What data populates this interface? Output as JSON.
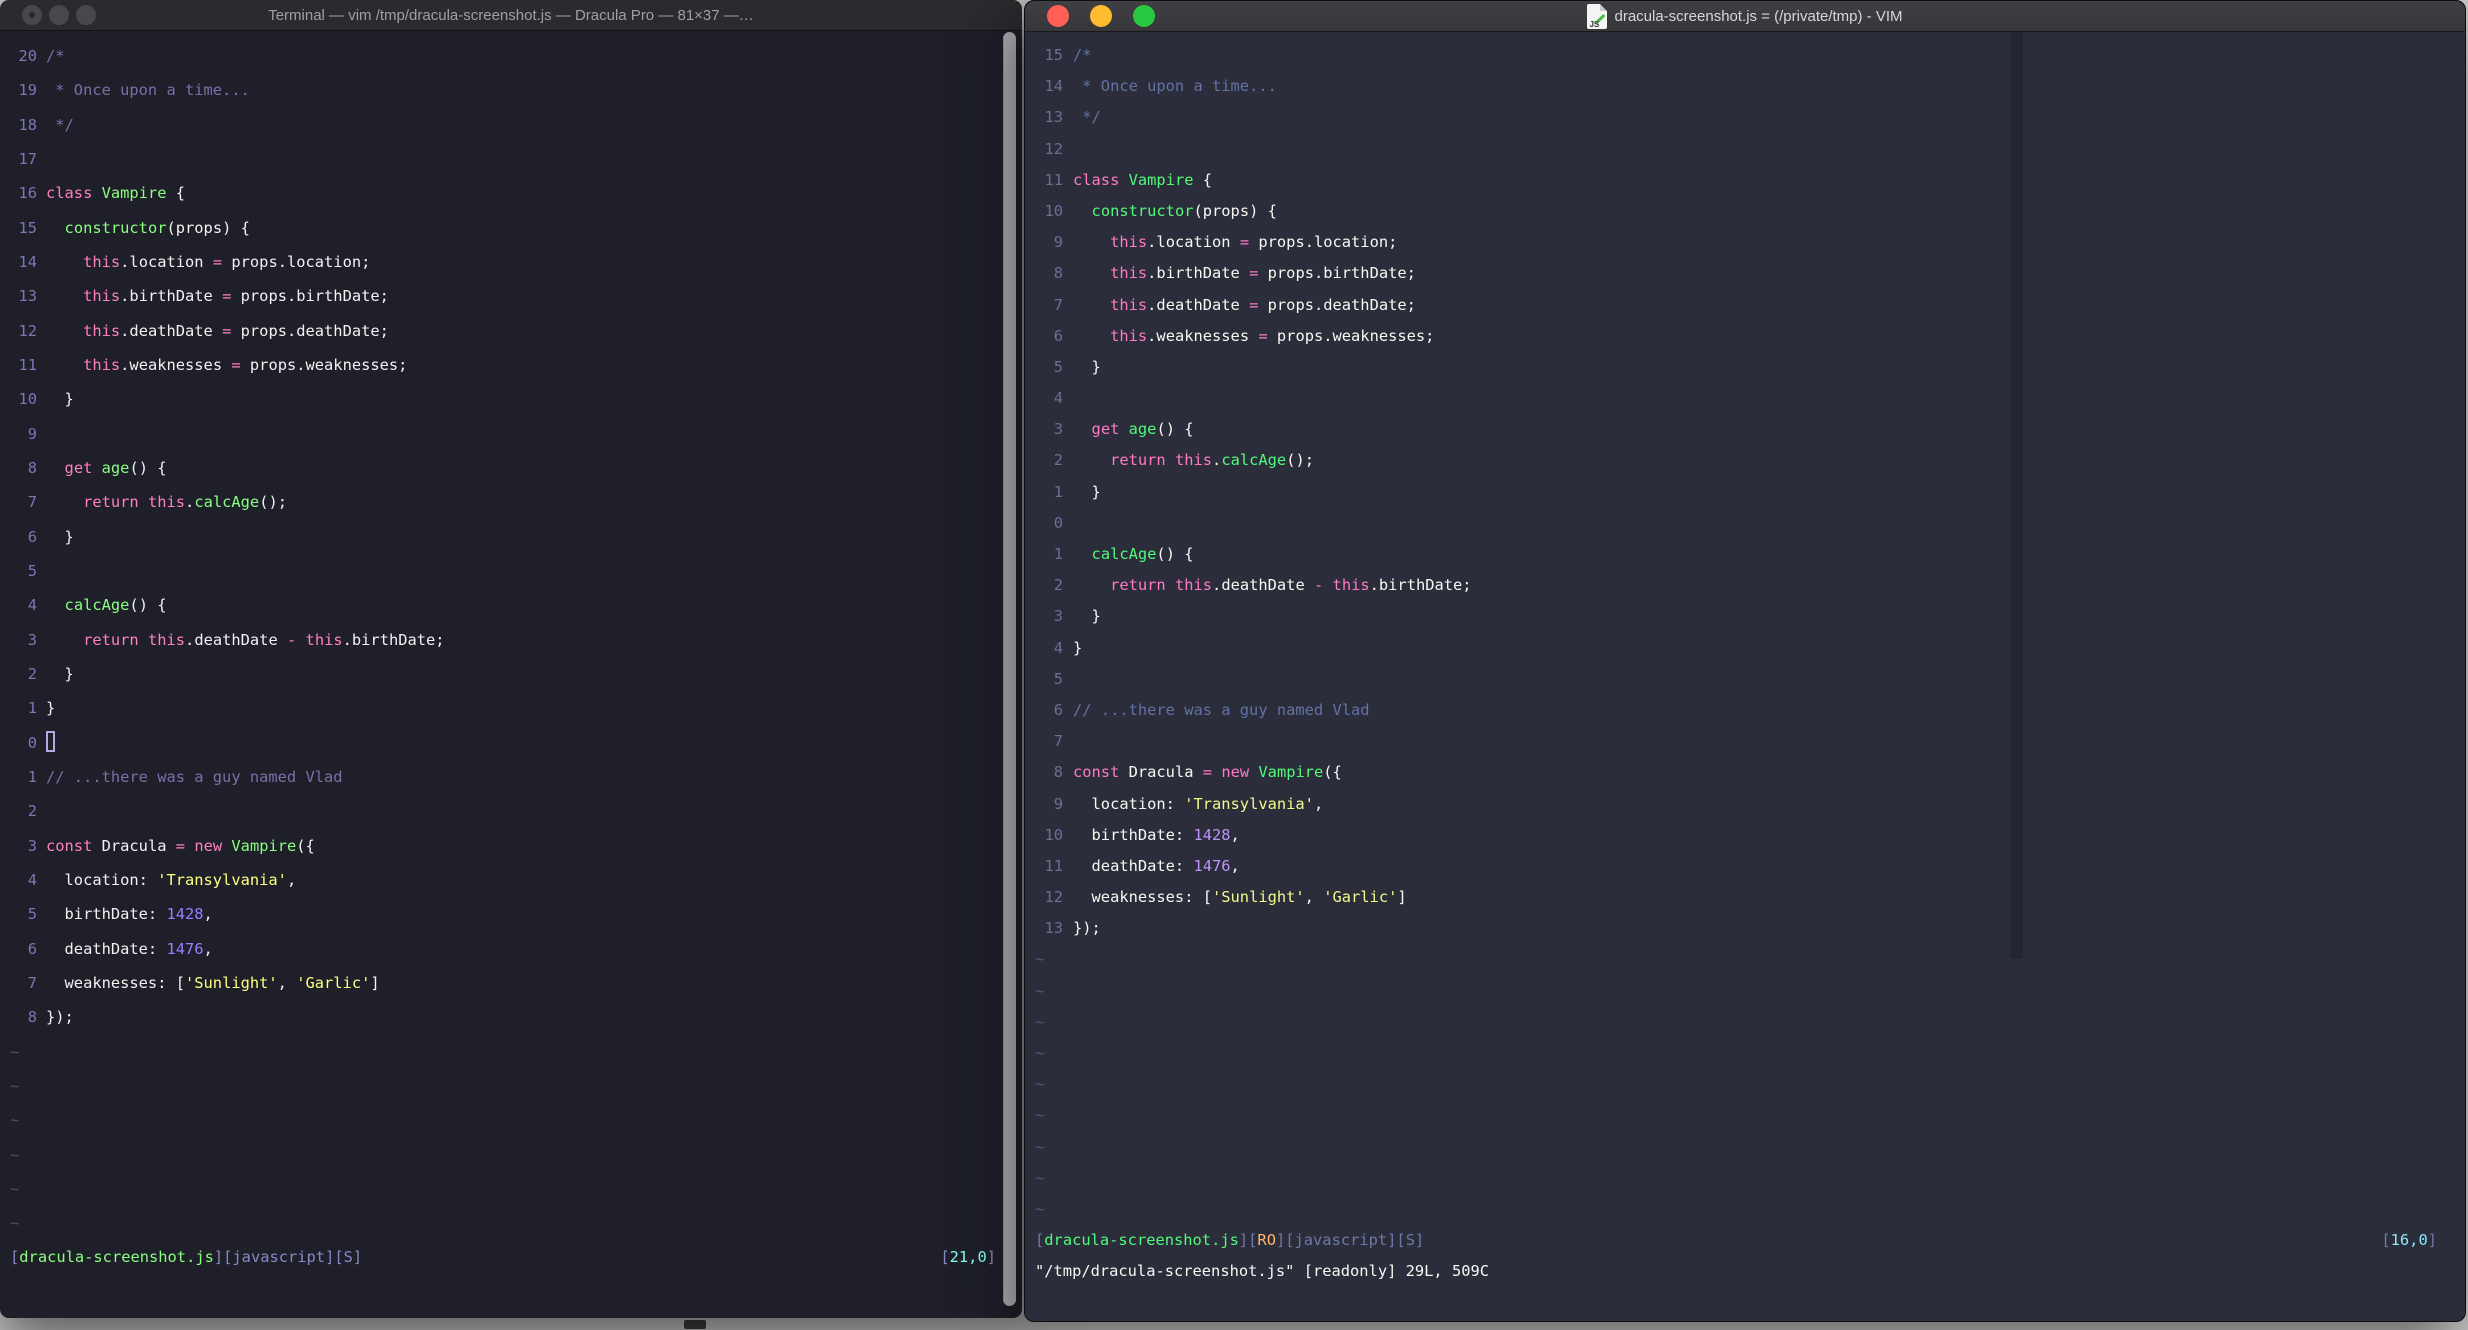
{
  "left_window": {
    "title": "Terminal — vim /tmp/dracula-screenshot.js — Dracula Pro — 81×37 —…",
    "theme_name": "Dracula Pro",
    "line_numbers": [
      20,
      19,
      18,
      17,
      16,
      15,
      14,
      13,
      12,
      11,
      10,
      9,
      8,
      7,
      6,
      5,
      4,
      3,
      2,
      1,
      0,
      1,
      2,
      3,
      4,
      5,
      6,
      7,
      8
    ],
    "cursor_line_index": 20,
    "show_cursor": true,
    "tilde_count": 6,
    "tilde_char": "~",
    "status_left": [
      [
        "m",
        "["
      ],
      [
        "fn",
        "dracula-screenshot.js"
      ],
      [
        "m",
        "][javascript][S]"
      ]
    ],
    "status_right": [
      [
        "m",
        "["
      ],
      [
        "cy",
        "21,0"
      ],
      [
        "m",
        "]"
      ]
    ],
    "palette": {
      "bg": "#1e1f29",
      "w": "#f2f2f0",
      "k": "#ff80bf",
      "f": "#8aff80",
      "s": "#ffff80",
      "n": "#9580ff",
      "c": "#7970a9",
      "m": "#8a87c9",
      "fn": "#8aff80",
      "cy": "#80ffea",
      "o": "#ffca80",
      "t": "#544f6b",
      "ln": "#7e76b5"
    }
  },
  "right_window": {
    "title": "dracula-screenshot.js = (/private/tmp) - VIM",
    "file_icon_label": "JS",
    "line_numbers": [
      15,
      14,
      13,
      12,
      11,
      10,
      9,
      8,
      7,
      6,
      5,
      4,
      3,
      2,
      1,
      0,
      1,
      2,
      3,
      4,
      5,
      6,
      7,
      8,
      9,
      10,
      11,
      12,
      13
    ],
    "cursor_line_index": 15,
    "show_cursor": false,
    "tilde_count": 9,
    "tilde_char": "~",
    "status_left": [
      [
        "m",
        "["
      ],
      [
        "fn",
        "dracula-screenshot.js"
      ],
      [
        "m",
        "]["
      ],
      [
        "o",
        "RO"
      ],
      [
        "m",
        "][javascript][S]"
      ]
    ],
    "status_right": [
      [
        "m",
        "["
      ],
      [
        "cy",
        "16,0"
      ],
      [
        "m",
        "]"
      ]
    ],
    "ex_line": "\"/tmp/dracula-screenshot.js\" [readonly] 29L, 509C",
    "palette": {
      "bg": "#2b2d3a",
      "w": "#f8f8f2",
      "k": "#ff79c6",
      "f": "#50fa7b",
      "s": "#f1fa8c",
      "n": "#bd93f9",
      "c": "#6272a4",
      "m": "#6d7aa8",
      "fn": "#50fa7b",
      "cy": "#8be9fd",
      "o": "#ffb86c",
      "t": "#535a70",
      "ln": "#6a7095"
    }
  },
  "code_lines": [
    [
      [
        "c",
        "/*"
      ]
    ],
    [
      [
        "c",
        " * Once upon a time..."
      ]
    ],
    [
      [
        "c",
        " */"
      ]
    ],
    [],
    [
      [
        "k",
        "class"
      ],
      [
        "w",
        " "
      ],
      [
        "f",
        "Vampire"
      ],
      [
        "w",
        " {"
      ]
    ],
    [
      [
        "w",
        "  "
      ],
      [
        "f",
        "constructor"
      ],
      [
        "w",
        "(props) {"
      ]
    ],
    [
      [
        "w",
        "    "
      ],
      [
        "k",
        "this"
      ],
      [
        "w",
        ".location "
      ],
      [
        "k",
        "="
      ],
      [
        "w",
        " props.location;"
      ]
    ],
    [
      [
        "w",
        "    "
      ],
      [
        "k",
        "this"
      ],
      [
        "w",
        ".birthDate "
      ],
      [
        "k",
        "="
      ],
      [
        "w",
        " props.birthDate;"
      ]
    ],
    [
      [
        "w",
        "    "
      ],
      [
        "k",
        "this"
      ],
      [
        "w",
        ".deathDate "
      ],
      [
        "k",
        "="
      ],
      [
        "w",
        " props.deathDate;"
      ]
    ],
    [
      [
        "w",
        "    "
      ],
      [
        "k",
        "this"
      ],
      [
        "w",
        ".weaknesses "
      ],
      [
        "k",
        "="
      ],
      [
        "w",
        " props.weaknesses;"
      ]
    ],
    [
      [
        "w",
        "  }"
      ]
    ],
    [],
    [
      [
        "w",
        "  "
      ],
      [
        "k",
        "get"
      ],
      [
        "w",
        " "
      ],
      [
        "f",
        "age"
      ],
      [
        "w",
        "() {"
      ]
    ],
    [
      [
        "w",
        "    "
      ],
      [
        "k",
        "return"
      ],
      [
        "w",
        " "
      ],
      [
        "k",
        "this"
      ],
      [
        "w",
        "."
      ],
      [
        "f",
        "calcAge"
      ],
      [
        "w",
        "();"
      ]
    ],
    [
      [
        "w",
        "  }"
      ]
    ],
    [],
    [
      [
        "w",
        "  "
      ],
      [
        "f",
        "calcAge"
      ],
      [
        "w",
        "() {"
      ]
    ],
    [
      [
        "w",
        "    "
      ],
      [
        "k",
        "return"
      ],
      [
        "w",
        " "
      ],
      [
        "k",
        "this"
      ],
      [
        "w",
        ".deathDate "
      ],
      [
        "k",
        "-"
      ],
      [
        "w",
        " "
      ],
      [
        "k",
        "this"
      ],
      [
        "w",
        ".birthDate;"
      ]
    ],
    [
      [
        "w",
        "  }"
      ]
    ],
    [
      [
        "w",
        "}"
      ]
    ],
    [],
    [
      [
        "c",
        "// ...there was a guy named Vlad"
      ]
    ],
    [],
    [
      [
        "k",
        "const"
      ],
      [
        "w",
        " Dracula "
      ],
      [
        "k",
        "="
      ],
      [
        "w",
        " "
      ],
      [
        "k",
        "new"
      ],
      [
        "w",
        " "
      ],
      [
        "f",
        "Vampire"
      ],
      [
        "w",
        "({"
      ]
    ],
    [
      [
        "w",
        "  location: "
      ],
      [
        "s",
        "'Transylvania'"
      ],
      [
        "w",
        ","
      ]
    ],
    [
      [
        "w",
        "  birthDate: "
      ],
      [
        "n",
        "1428"
      ],
      [
        "w",
        ","
      ]
    ],
    [
      [
        "w",
        "  deathDate: "
      ],
      [
        "n",
        "1476"
      ],
      [
        "w",
        ","
      ]
    ],
    [
      [
        "w",
        "  weaknesses: ["
      ],
      [
        "s",
        "'Sunlight'"
      ],
      [
        "w",
        ", "
      ],
      [
        "s",
        "'Garlic'"
      ],
      [
        "w",
        "]"
      ]
    ],
    [
      [
        "w",
        "});"
      ]
    ]
  ]
}
